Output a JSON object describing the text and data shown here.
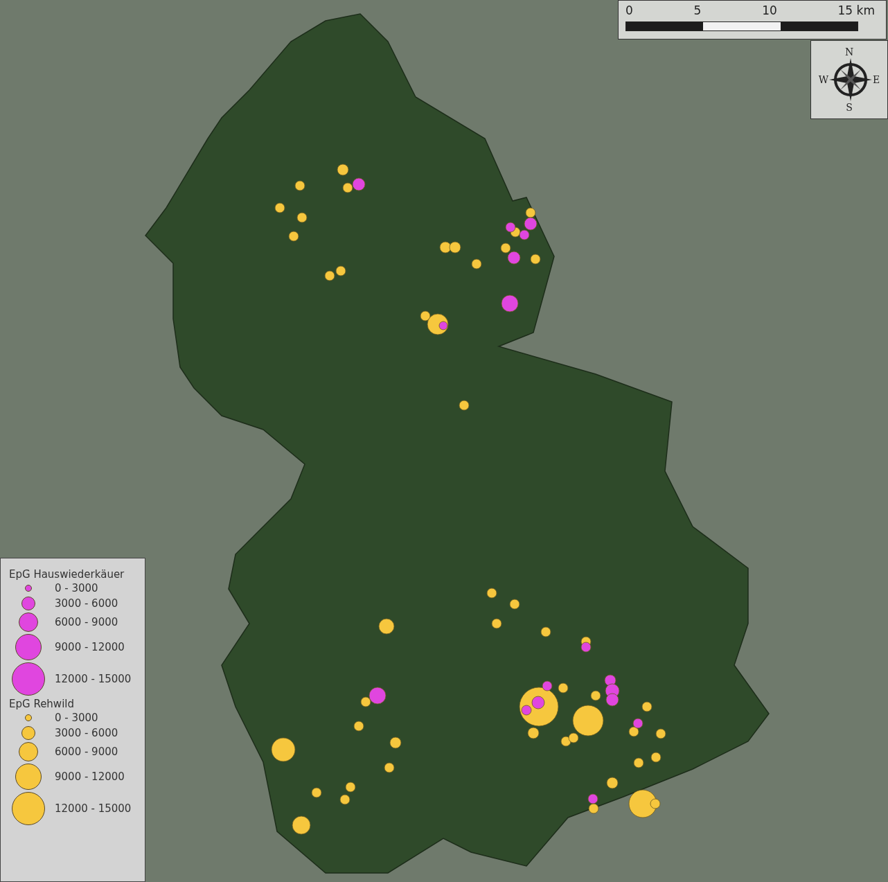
{
  "scale_bar": {
    "ticks": [
      "0",
      "5",
      "10",
      "15 km"
    ]
  },
  "compass": {
    "north": "N",
    "west": "W",
    "east": "E",
    "south": "S"
  },
  "legend": {
    "groups": [
      {
        "title": "EpG Hauswiederkäuer",
        "color": "#e046df",
        "items": [
          "0 - 3000",
          "3000 - 6000",
          "6000 - 9000",
          "9000 - 12000",
          "12000 - 15000"
        ]
      },
      {
        "title": "EpG Rehwild",
        "color": "#f6c73e",
        "items": [
          "0 - 3000",
          "3000 - 6000",
          "6000 - 9000",
          "9000 - 12000",
          "12000 - 15000"
        ]
      }
    ]
  }
}
